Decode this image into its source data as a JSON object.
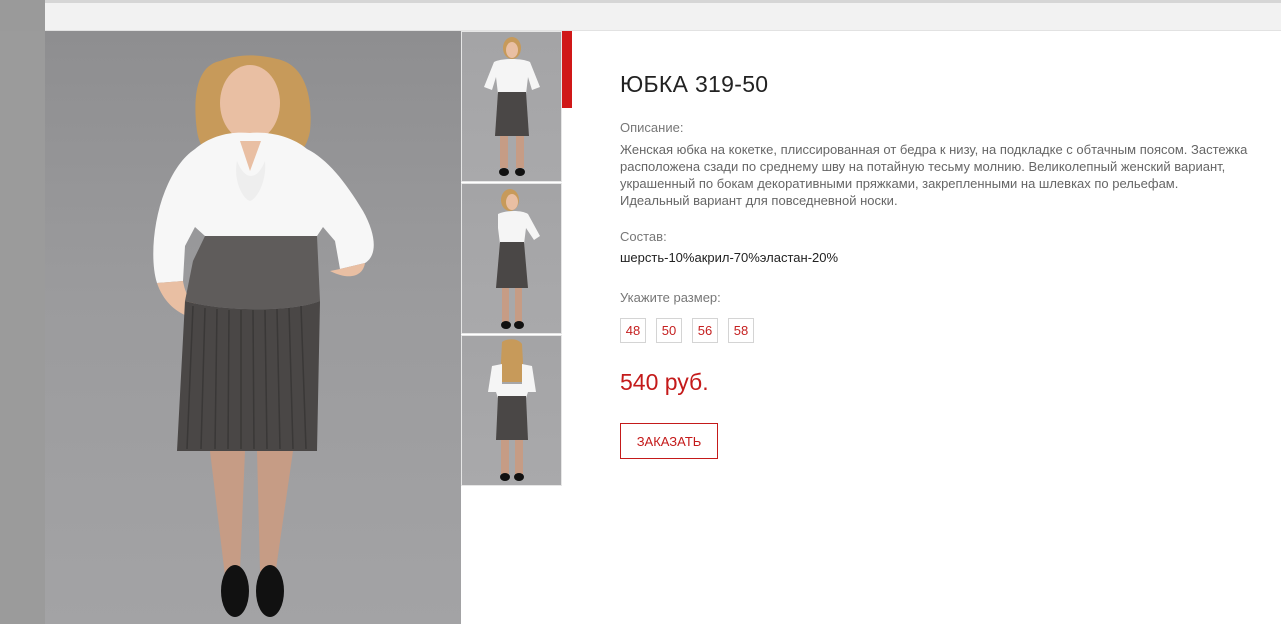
{
  "product": {
    "title": "ЮБКА 319-50",
    "description_label": "Описание:",
    "description": "Женская юбка на кокетке, плиссированная от бедра к низу, на подкладке с обтачным поясом. Застежка расположена сзади по среднему шву на потайную тесьму молнию. Великолепный женский вариант, украшенный по бокам декоративными пряжками, закрепленными на шлевках по рельефам. Идеальный вариант для повседневной носки.",
    "composition_label": "Состав:",
    "composition": "шерсть-10%акрил-70%эластан-20%",
    "size_label": "Укажите размер:",
    "sizes": [
      "48",
      "50",
      "56",
      "58"
    ],
    "price": "540 руб.",
    "order_button": "ЗАКАЗАТЬ"
  },
  "gallery": {
    "main_image": "model-front-photo",
    "thumbnails": [
      "thumb-front",
      "thumb-side",
      "thumb-back"
    ],
    "active_thumbnail": 0
  },
  "colors": {
    "accent": "#d01818",
    "price": "#c41a1a",
    "background_rail": "#9b9b9b"
  }
}
